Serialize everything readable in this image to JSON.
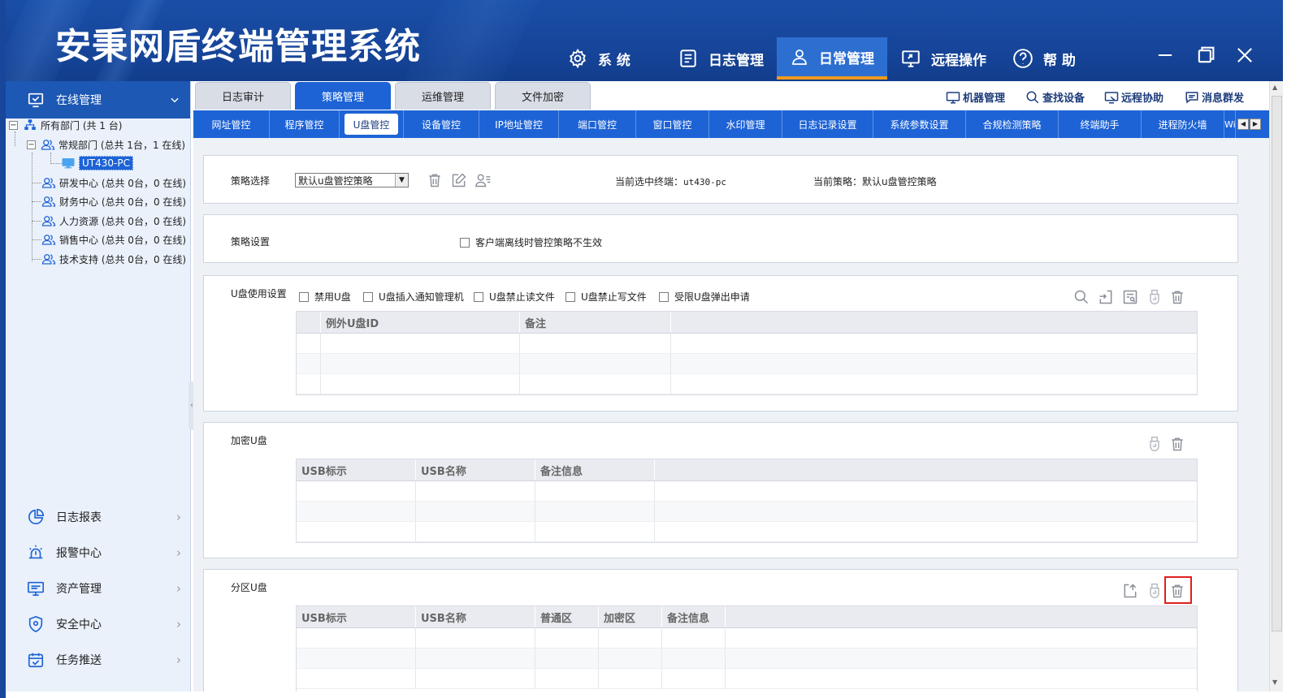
{
  "app": {
    "title": "安秉网盾终端管理系统"
  },
  "topnav": [
    {
      "label": "系 统",
      "icon": "gear-icon"
    },
    {
      "label": "日志管理",
      "icon": "document-icon"
    },
    {
      "label": "日常管理",
      "icon": "user-icon",
      "active": true
    },
    {
      "label": "远程操作",
      "icon": "remote-screen-icon"
    },
    {
      "label": "帮 助",
      "icon": "help-icon"
    }
  ],
  "window_controls": [
    "minimize-icon",
    "restore-icon",
    "close-icon"
  ],
  "sidebar": {
    "header": "在线管理",
    "tree": {
      "root": "所有部门 (共 1 台)",
      "groups": [
        {
          "label": "常规部门 (总共 1台，1 在线)",
          "expanded": true,
          "children": [
            "UT430-PC"
          ]
        },
        {
          "label": "研发中心 (总共 0台，0 在线)"
        },
        {
          "label": "财务中心 (总共 0台，0 在线)"
        },
        {
          "label": "人力资源 (总共 0台，0 在线)"
        },
        {
          "label": "销售中心 (总共 0台，0 在线)"
        },
        {
          "label": "技术支持 (总共 0台，0 在线)"
        }
      ]
    },
    "menu": [
      {
        "label": "日志报表",
        "icon": "pie-chart-icon"
      },
      {
        "label": "报警中心",
        "icon": "alarm-icon"
      },
      {
        "label": "资产管理",
        "icon": "monitor-icon"
      },
      {
        "label": "安全中心",
        "icon": "shield-icon"
      },
      {
        "label": "任务推送",
        "icon": "calendar-check-icon"
      }
    ]
  },
  "main_tabs": [
    {
      "label": "日志审计"
    },
    {
      "label": "策略管理",
      "active": true
    },
    {
      "label": "运维管理"
    },
    {
      "label": "文件加密"
    }
  ],
  "tools": [
    {
      "label": "机器管理",
      "icon": "monitor-icon"
    },
    {
      "label": "查找设备",
      "icon": "search-icon"
    },
    {
      "label": "远程协助",
      "icon": "remote-assist-icon"
    },
    {
      "label": "消息群发",
      "icon": "message-icon"
    }
  ],
  "subnav": [
    {
      "label": "网址管控"
    },
    {
      "label": "程序管控"
    },
    {
      "label": "U盘管控",
      "active": true
    },
    {
      "label": "设备管控"
    },
    {
      "label": "IP地址管控"
    },
    {
      "label": "端口管控"
    },
    {
      "label": "窗口管控"
    },
    {
      "label": "水印管理"
    },
    {
      "label": "日志记录设置"
    },
    {
      "label": "系统参数设置"
    },
    {
      "label": "合规检测策略"
    },
    {
      "label": "终端助手"
    },
    {
      "label": "进程防火墙"
    },
    {
      "label": "Wif"
    }
  ],
  "policy_select": {
    "label": "策略选择",
    "value": "默认u盘管控策略",
    "current_terminal_label": "当前选中终端：",
    "current_terminal": "ut430-pc",
    "current_policy_label": "当前策略：",
    "current_policy": "默认u盘管控策略"
  },
  "policy_settings": {
    "label": "策略设置",
    "offline_checkbox": "客户端离线时管控策略不生效"
  },
  "usb_usage": {
    "label": "U盘使用设置",
    "checkboxes": [
      "禁用U盘",
      "U盘插入通知管理机",
      "U盘禁止读文件",
      "U盘禁止写文件",
      "受限U盘弹出申请"
    ],
    "columns": [
      "例外U盘ID",
      "备注"
    ]
  },
  "encrypted_usb": {
    "label": "加密U盘",
    "columns": [
      "USB标示",
      "USB名称",
      "备注信息"
    ]
  },
  "partition_usb": {
    "label": "分区U盘",
    "columns": [
      "USB标示",
      "USB名称",
      "普通区",
      "加密区",
      "备注信息"
    ]
  }
}
